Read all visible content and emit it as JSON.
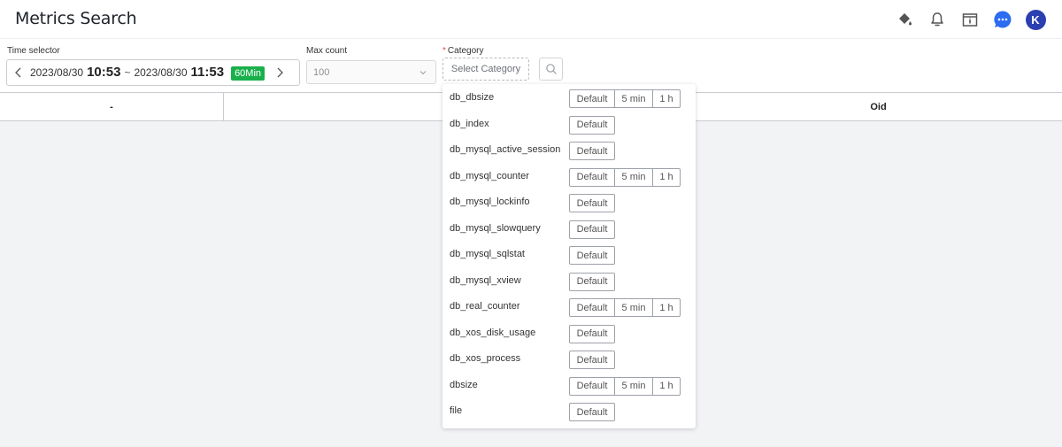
{
  "page": {
    "title": "Metrics Search"
  },
  "header": {
    "icons": [
      "paint-bucket-icon",
      "bell-icon",
      "info-panel-icon",
      "chat-icon"
    ],
    "avatar_letter": "K"
  },
  "filters": {
    "time_label": "Time selector",
    "time": {
      "start_date": "2023/08/30",
      "start_time": "10:53",
      "separator": "~",
      "end_date": "2023/08/30",
      "end_time": "11:53",
      "duration": "60Min"
    },
    "max_count_label": "Max count",
    "max_count_value": "100",
    "category_required": "*",
    "category_label": "Category",
    "category_placeholder": "Select Category"
  },
  "table": {
    "columns": [
      "-",
      "",
      "Oid"
    ]
  },
  "categories": [
    {
      "name": "db_dbsize",
      "options": [
        "Default",
        "5 min",
        "1 h"
      ]
    },
    {
      "name": "db_index",
      "options": [
        "Default"
      ]
    },
    {
      "name": "db_mysql_active_session",
      "options": [
        "Default"
      ]
    },
    {
      "name": "db_mysql_counter",
      "options": [
        "Default",
        "5 min",
        "1 h"
      ]
    },
    {
      "name": "db_mysql_lockinfo",
      "options": [
        "Default"
      ]
    },
    {
      "name": "db_mysql_slowquery",
      "options": [
        "Default"
      ]
    },
    {
      "name": "db_mysql_sqlstat",
      "options": [
        "Default"
      ]
    },
    {
      "name": "db_mysql_xview",
      "options": [
        "Default"
      ]
    },
    {
      "name": "db_real_counter",
      "options": [
        "Default",
        "5 min",
        "1 h"
      ]
    },
    {
      "name": "db_xos_disk_usage",
      "options": [
        "Default"
      ]
    },
    {
      "name": "db_xos_process",
      "options": [
        "Default"
      ]
    },
    {
      "name": "dbsize",
      "options": [
        "Default",
        "5 min",
        "1 h"
      ]
    },
    {
      "name": "file",
      "options": [
        "Default"
      ]
    }
  ],
  "colors": {
    "accent": "#2b6cf0",
    "avatar": "#2b3fb0",
    "duration_badge": "#19b04b",
    "required": "#e5484d"
  }
}
